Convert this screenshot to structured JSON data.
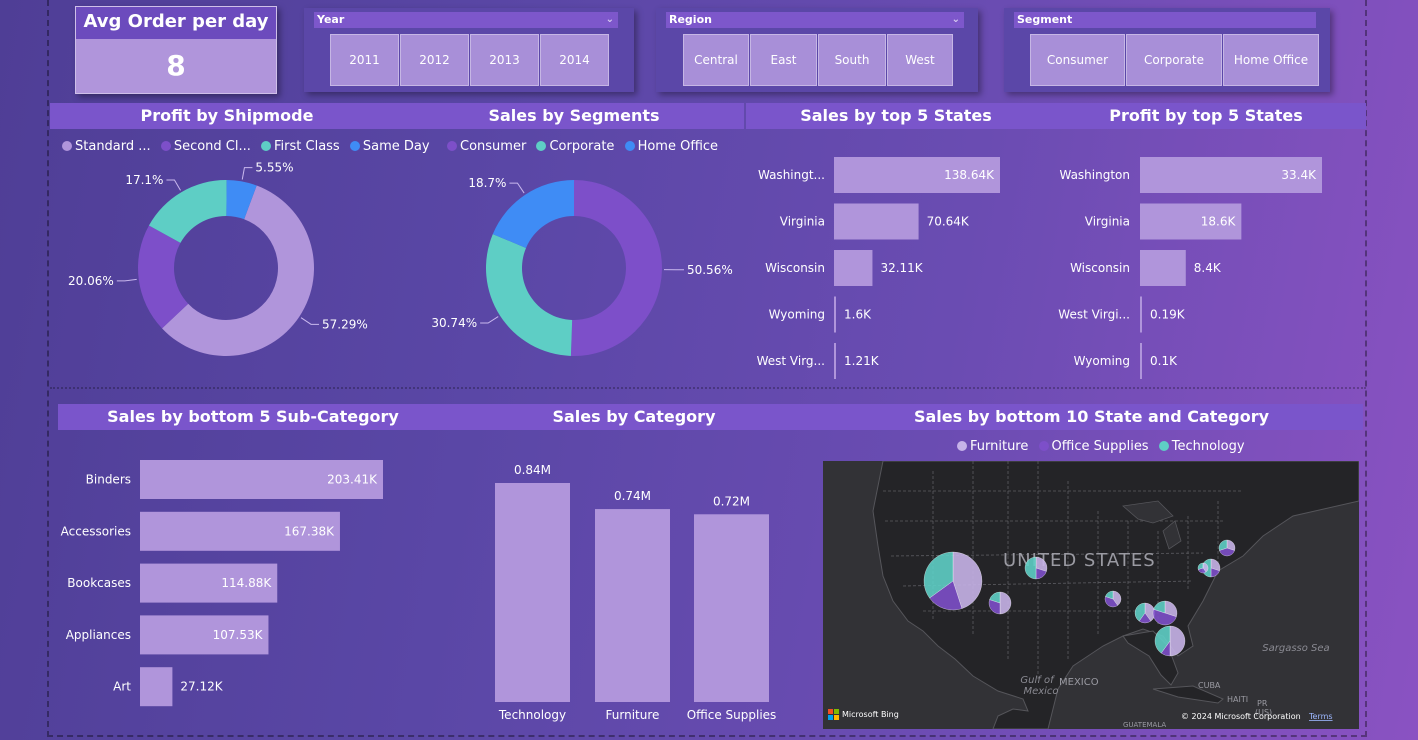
{
  "kpi": {
    "title": "Avg Order per day",
    "value": "8"
  },
  "slicers": {
    "year": {
      "title": "Year",
      "options": [
        "2011",
        "2012",
        "2013",
        "2014"
      ]
    },
    "region": {
      "title": "Region",
      "options": [
        "Central",
        "East",
        "South",
        "West"
      ]
    },
    "segment": {
      "title": "Segment",
      "options": [
        "Consumer",
        "Corporate",
        "Home Office"
      ]
    }
  },
  "colors": {
    "standard": "#b095db",
    "second": "#7d4fc9",
    "first": "#5ecec5",
    "same_day": "#3f8cf5",
    "consumer": "#7d4fc9",
    "corporate": "#5ecec5",
    "home_office": "#3f8cf5",
    "bar": "#b095db",
    "furniture": "#c6b3e8",
    "office_supplies": "#7d4fc9",
    "technology": "#5ecec5"
  },
  "charts": {
    "shipmode": {
      "title": "Profit by Shipmode",
      "legend": [
        "Standard ...",
        "Second Cl...",
        "First Class",
        "Same Day"
      ]
    },
    "segments": {
      "title": "Sales by Segments",
      "legend": [
        "Consumer",
        "Corporate",
        "Home Office"
      ]
    },
    "states_sales": {
      "title": "Sales by top 5 States"
    },
    "states_profit": {
      "title": "Profit by top 5 States"
    },
    "subcat": {
      "title": "Sales by bottom 5 Sub-Category"
    },
    "category": {
      "title": "Sales by Category"
    },
    "map": {
      "title": "Sales by bottom 10 State and Category",
      "legend": [
        "Furniture",
        "Office Supplies",
        "Technology"
      ],
      "labels": {
        "country": "UNITED STATES",
        "mexico": "MEXICO",
        "gulf1": "Gulf of",
        "gulf2": "Mexico",
        "sea": "Sargasso Sea",
        "cuba": "CUBA",
        "haiti": "HAITI",
        "pr": "PR",
        "us": "(US)",
        "guatemala": "GUATEMALA",
        "bing": "Microsoft Bing",
        "copyright": "© 2024 Microsoft Corporation",
        "terms": "Terms"
      }
    }
  },
  "chart_data": [
    {
      "type": "pie",
      "title": "Profit by Shipmode",
      "categories": [
        "Standard ...",
        "Second Cl...",
        "First Class",
        "Same Day"
      ],
      "values": [
        57.29,
        20.06,
        17.1,
        5.55
      ],
      "labels": [
        "57.29%",
        "20.06%",
        "17.1%",
        "5.55%"
      ],
      "legend": "top-left"
    },
    {
      "type": "pie",
      "title": "Sales by Segments",
      "categories": [
        "Consumer",
        "Corporate",
        "Home Office"
      ],
      "values": [
        50.56,
        30.74,
        18.7
      ],
      "labels": [
        "50.56%",
        "30.74%",
        "18.7%"
      ],
      "legend": "top-left"
    },
    {
      "type": "bar",
      "title": "Sales by top 5 States",
      "categories": [
        "Washingt...",
        "Virginia",
        "Wisconsin",
        "Wyoming",
        "West Virg..."
      ],
      "values": [
        138640,
        70640,
        32110,
        1600,
        1210
      ],
      "labels": [
        "138.64K",
        "70.64K",
        "32.11K",
        "1.6K",
        "1.21K"
      ]
    },
    {
      "type": "bar",
      "title": "Profit by top 5 States",
      "categories": [
        "Washington",
        "Virginia",
        "Wisconsin",
        "West Virgi...",
        "Wyoming"
      ],
      "values": [
        33400,
        18600,
        8400,
        190,
        100
      ],
      "labels": [
        "33.4K",
        "18.6K",
        "8.4K",
        "0.19K",
        "0.1K"
      ]
    },
    {
      "type": "bar",
      "title": "Sales by bottom 5 Sub-Category",
      "categories": [
        "Binders",
        "Accessories",
        "Bookcases",
        "Appliances",
        "Art"
      ],
      "values": [
        203410,
        167380,
        114880,
        107530,
        27120
      ],
      "labels": [
        "203.41K",
        "167.38K",
        "114.88K",
        "107.53K",
        "27.12K"
      ]
    },
    {
      "type": "bar",
      "title": "Sales by Category",
      "categories": [
        "Technology",
        "Furniture",
        "Office Supplies"
      ],
      "values": [
        0.84,
        0.74,
        0.72
      ],
      "labels": [
        "0.84M",
        "0.74M",
        "0.72M"
      ]
    }
  ]
}
